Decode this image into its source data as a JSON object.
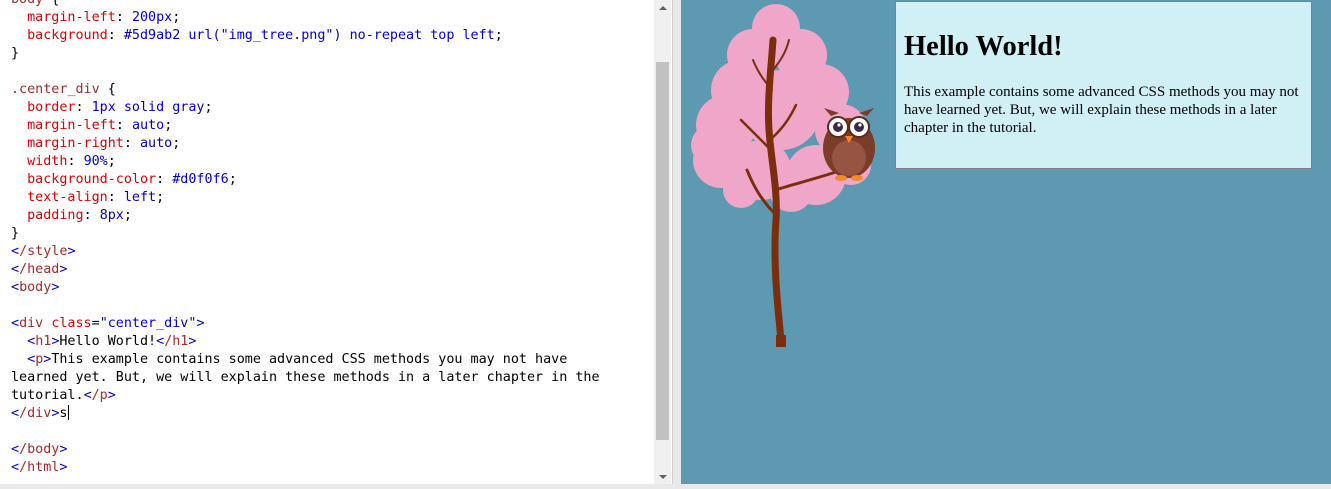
{
  "editor": {
    "lines": [
      {
        "segments": [
          [
            "c-sel",
            "body"
          ],
          [
            "c-txt",
            " {"
          ]
        ]
      },
      {
        "segments": [
          [
            "c-txt",
            "  "
          ],
          [
            "c-prop",
            "margin-left"
          ],
          [
            "c-txt",
            ": "
          ],
          [
            "c-val",
            "200px"
          ],
          [
            "c-txt",
            ";"
          ]
        ]
      },
      {
        "segments": [
          [
            "c-txt",
            "  "
          ],
          [
            "c-prop",
            "background"
          ],
          [
            "c-txt",
            ": "
          ],
          [
            "c-val",
            "#5d9ab2 url(\"img_tree.png\") no-repeat top left"
          ],
          [
            "c-txt",
            ";"
          ]
        ]
      },
      {
        "segments": [
          [
            "c-txt",
            "}"
          ]
        ]
      },
      {
        "segments": [
          [
            "c-txt",
            ""
          ]
        ]
      },
      {
        "segments": [
          [
            "c-sel",
            ".center_div"
          ],
          [
            "c-txt",
            " {"
          ]
        ]
      },
      {
        "segments": [
          [
            "c-txt",
            "  "
          ],
          [
            "c-prop",
            "border"
          ],
          [
            "c-txt",
            ": "
          ],
          [
            "c-val",
            "1px solid gray"
          ],
          [
            "c-txt",
            ";"
          ]
        ]
      },
      {
        "segments": [
          [
            "c-txt",
            "  "
          ],
          [
            "c-prop",
            "margin-left"
          ],
          [
            "c-txt",
            ": "
          ],
          [
            "c-val",
            "auto"
          ],
          [
            "c-txt",
            ";"
          ]
        ]
      },
      {
        "segments": [
          [
            "c-txt",
            "  "
          ],
          [
            "c-prop",
            "margin-right"
          ],
          [
            "c-txt",
            ": "
          ],
          [
            "c-val",
            "auto"
          ],
          [
            "c-txt",
            ";"
          ]
        ]
      },
      {
        "segments": [
          [
            "c-txt",
            "  "
          ],
          [
            "c-prop",
            "width"
          ],
          [
            "c-txt",
            ": "
          ],
          [
            "c-val",
            "90%"
          ],
          [
            "c-txt",
            ";"
          ]
        ]
      },
      {
        "segments": [
          [
            "c-txt",
            "  "
          ],
          [
            "c-prop",
            "background-color"
          ],
          [
            "c-txt",
            ": "
          ],
          [
            "c-val",
            "#d0f0f6"
          ],
          [
            "c-txt",
            ";"
          ]
        ]
      },
      {
        "segments": [
          [
            "c-txt",
            "  "
          ],
          [
            "c-prop",
            "text-align"
          ],
          [
            "c-txt",
            ": "
          ],
          [
            "c-val",
            "left"
          ],
          [
            "c-txt",
            ";"
          ]
        ]
      },
      {
        "segments": [
          [
            "c-txt",
            "  "
          ],
          [
            "c-prop",
            "padding"
          ],
          [
            "c-txt",
            ": "
          ],
          [
            "c-val",
            "8px"
          ],
          [
            "c-txt",
            ";"
          ]
        ]
      },
      {
        "segments": [
          [
            "c-txt",
            "}"
          ]
        ]
      },
      {
        "segments": [
          [
            "c-br",
            "<"
          ],
          [
            "c-tag",
            "/style"
          ],
          [
            "c-br",
            ">"
          ]
        ]
      },
      {
        "segments": [
          [
            "c-br",
            "<"
          ],
          [
            "c-tag",
            "/head"
          ],
          [
            "c-br",
            ">"
          ]
        ]
      },
      {
        "segments": [
          [
            "c-br",
            "<"
          ],
          [
            "c-tag",
            "body"
          ],
          [
            "c-br",
            ">"
          ]
        ]
      },
      {
        "segments": [
          [
            "c-txt",
            ""
          ]
        ]
      },
      {
        "segments": [
          [
            "c-br",
            "<"
          ],
          [
            "c-tag",
            "div "
          ],
          [
            "c-attr",
            "class"
          ],
          [
            "c-txt",
            "="
          ],
          [
            "c-str",
            "\"center_div\""
          ],
          [
            "c-br",
            ">"
          ]
        ]
      },
      {
        "segments": [
          [
            "c-txt",
            "  "
          ],
          [
            "c-br",
            "<"
          ],
          [
            "c-tag",
            "h1"
          ],
          [
            "c-br",
            ">"
          ],
          [
            "c-txt",
            "Hello World!"
          ],
          [
            "c-br",
            "<"
          ],
          [
            "c-tag",
            "/h1"
          ],
          [
            "c-br",
            ">"
          ]
        ]
      },
      {
        "segments": [
          [
            "c-txt",
            "  "
          ],
          [
            "c-br",
            "<"
          ],
          [
            "c-tag",
            "p"
          ],
          [
            "c-br",
            ">"
          ],
          [
            "c-txt",
            "This example contains some advanced CSS methods you may not have"
          ]
        ]
      },
      {
        "segments": [
          [
            "c-txt",
            "learned yet. But, we will explain these methods in a later chapter in the"
          ]
        ]
      },
      {
        "segments": [
          [
            "c-txt",
            "tutorial."
          ],
          [
            "c-br",
            "<"
          ],
          [
            "c-tag",
            "/p"
          ],
          [
            "c-br",
            ">"
          ]
        ]
      },
      {
        "segments": [
          [
            "c-br",
            "<"
          ],
          [
            "c-tag",
            "/div"
          ],
          [
            "c-br",
            ">"
          ],
          [
            "c-txt",
            "s"
          ]
        ],
        "caret": true
      },
      {
        "segments": [
          [
            "c-txt",
            ""
          ]
        ]
      },
      {
        "segments": [
          [
            "c-br",
            "<"
          ],
          [
            "c-tag",
            "/body"
          ],
          [
            "c-br",
            ">"
          ]
        ]
      },
      {
        "segments": [
          [
            "c-br",
            "<"
          ],
          [
            "c-tag",
            "/html"
          ],
          [
            "c-br",
            ">"
          ]
        ]
      }
    ]
  },
  "result": {
    "background": "#5d9ab2",
    "box_background": "#d0f0f6",
    "heading": "Hello World!",
    "paragraph": "This example contains some advanced CSS methods you may not have learned yet. But, we will explain these methods in a later chapter in the tutorial."
  }
}
